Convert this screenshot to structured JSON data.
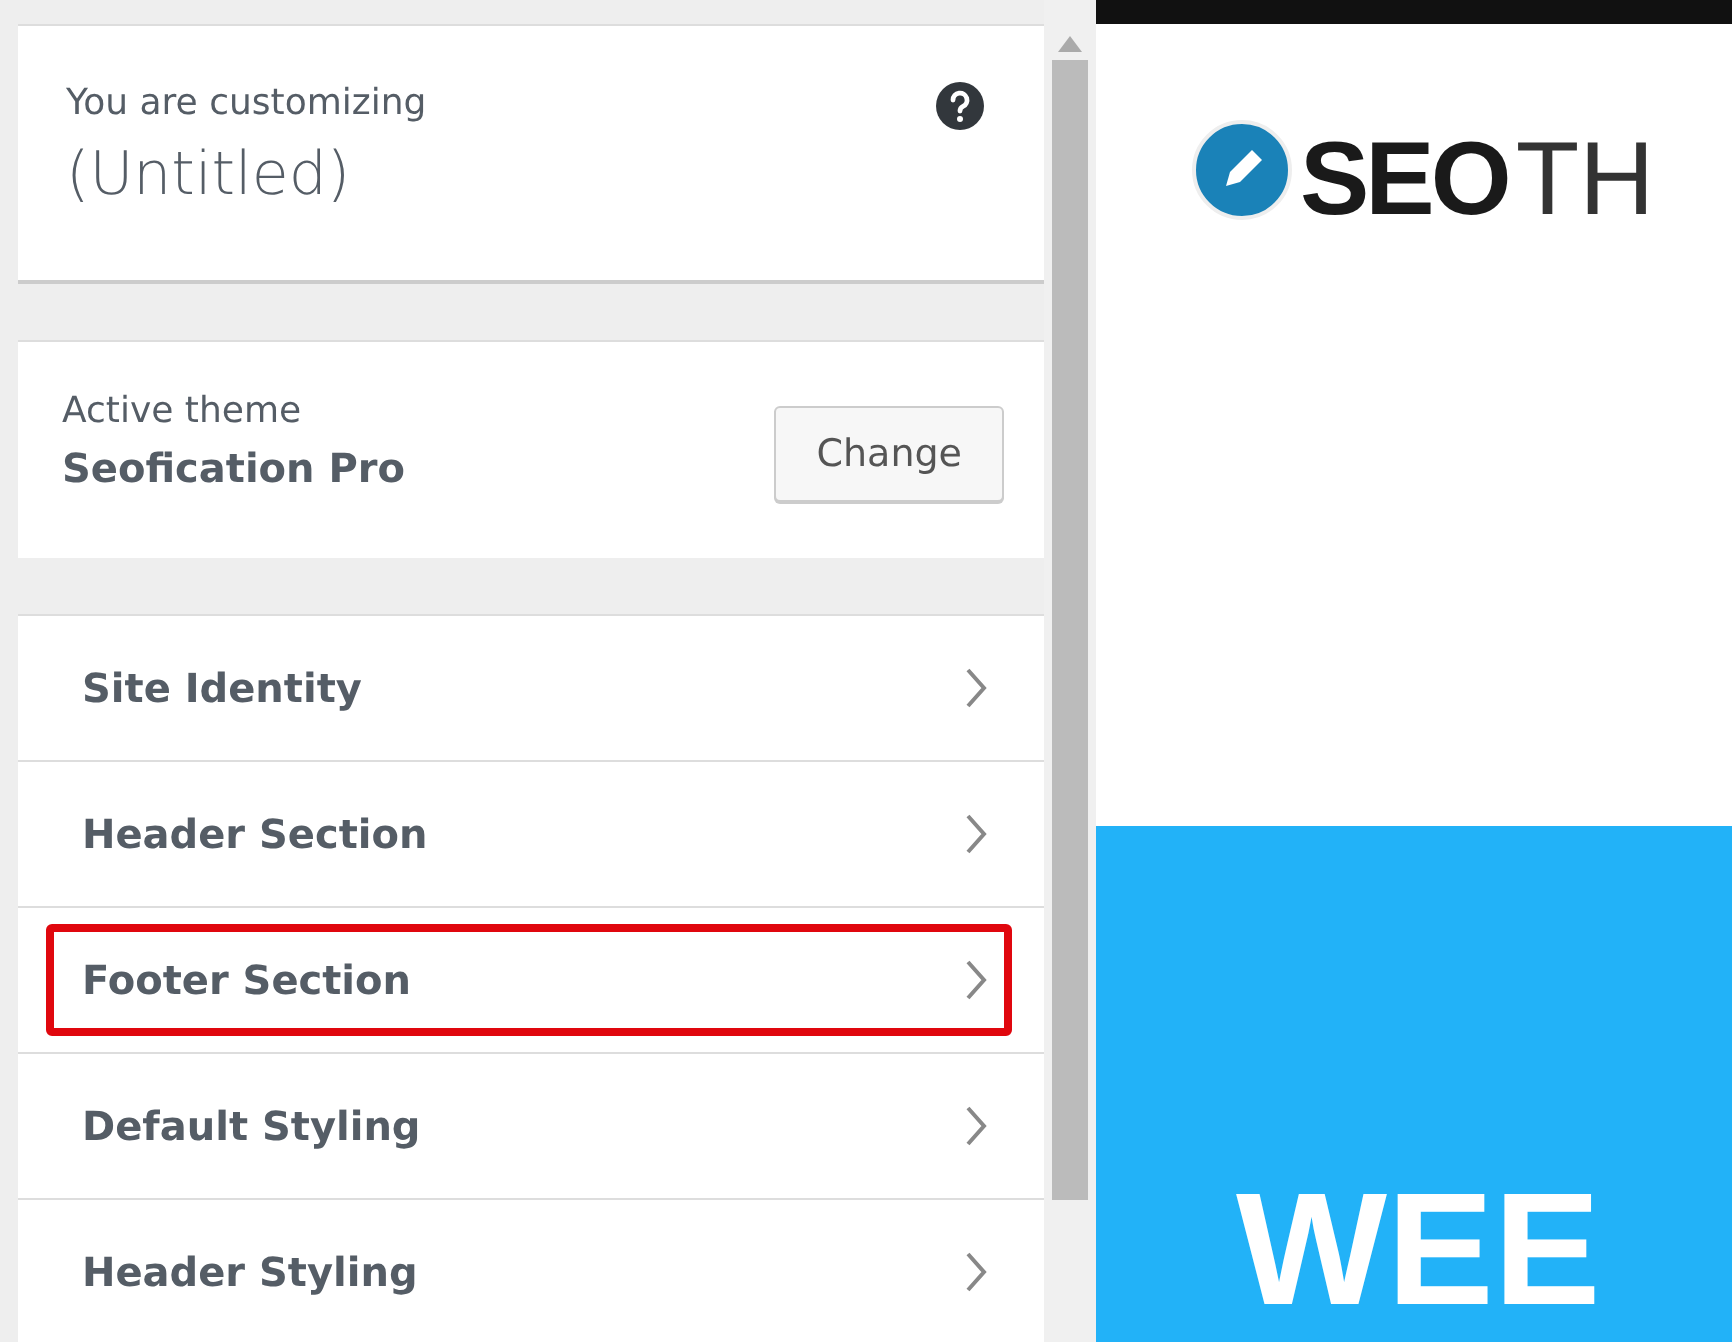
{
  "header": {
    "label": "You are customizing",
    "title": "(Untitled)"
  },
  "theme": {
    "label": "Active theme",
    "name": "Seofication Pro",
    "button": "Change"
  },
  "sections": [
    {
      "label": "Site Identity",
      "highlighted": false
    },
    {
      "label": "Header Section",
      "highlighted": false
    },
    {
      "label": "Footer Section",
      "highlighted": true
    },
    {
      "label": "Default Styling",
      "highlighted": false
    },
    {
      "label": "Header Styling",
      "highlighted": false
    }
  ],
  "preview": {
    "logo_bold": "SEO",
    "logo_light": "TH",
    "hero_text": "WEE"
  }
}
